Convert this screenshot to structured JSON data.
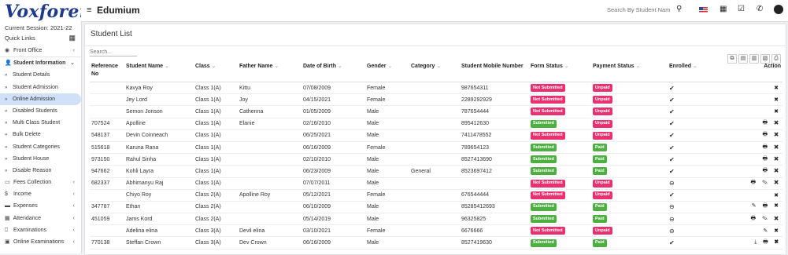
{
  "app": {
    "logo": "Voxforem",
    "title": "Edumium"
  },
  "sidebar": {
    "session": "Current Session: 2021-22",
    "quick_links": "Quick Links",
    "items": [
      {
        "label": "Front Office",
        "icon": "eye-icon",
        "type": "top",
        "chev": "‹"
      },
      {
        "label": "Student Information",
        "icon": "user-icon",
        "type": "bold",
        "chev": "⌄"
      },
      {
        "label": "Student Details",
        "type": "sub"
      },
      {
        "label": "Student Admission",
        "type": "sub"
      },
      {
        "label": "Online Admission",
        "type": "sub",
        "active": true
      },
      {
        "label": "Disabled Students",
        "type": "sub"
      },
      {
        "label": "Multi Class Student",
        "type": "sub"
      },
      {
        "label": "Bulk Delete",
        "type": "sub"
      },
      {
        "label": "Student Categories",
        "type": "sub"
      },
      {
        "label": "Student House",
        "type": "sub"
      },
      {
        "label": "Disable Reason",
        "type": "sub"
      },
      {
        "label": "Fees Collection",
        "icon": "money-icon",
        "chev": "‹"
      },
      {
        "label": "Income",
        "icon": "dollar-icon",
        "chev": "‹"
      },
      {
        "label": "Expenses",
        "icon": "card-icon",
        "chev": "‹"
      },
      {
        "label": "Attendance",
        "icon": "calendar-icon",
        "chev": "‹"
      },
      {
        "label": "Examinations",
        "icon": "book-icon",
        "chev": "‹"
      },
      {
        "label": "Online Examinations",
        "icon": "laptop-icon",
        "chev": "‹"
      }
    ]
  },
  "topbar": {
    "search_placeholder": "Search By Student Name"
  },
  "panel": {
    "title": "Student List",
    "search_placeholder": "Search..."
  },
  "table": {
    "headers": [
      "Reference No",
      "Student Name",
      "Class",
      "Father Name",
      "Date of Birth",
      "Gender",
      "Category",
      "Student Mobile Number",
      "Form Status",
      "Payment Status",
      "Enrolled",
      "Action"
    ],
    "rows": [
      {
        "ref": "",
        "name": "Kavya Roy",
        "class": "Class 1(A)",
        "father": "Kittu",
        "dob": "07/08/2009",
        "gender": "Female",
        "category": "",
        "mobile": "987654311",
        "form": "Not Submitted",
        "payment": "Unpaid",
        "enrolled": "✔",
        "actions": "✖"
      },
      {
        "ref": "",
        "name": "Jey Lord",
        "class": "Class 1(A)",
        "father": "Joy",
        "dob": "04/15/2021",
        "gender": "Female",
        "category": "",
        "mobile": "2289292929",
        "form": "Not Submitted",
        "payment": "Unpaid",
        "enrolled": "✔",
        "actions": "✖"
      },
      {
        "ref": "",
        "name": "Semon Jonson",
        "class": "Class 1(A)",
        "father": "Cathenna",
        "dob": "01/05/2009",
        "gender": "Male",
        "category": "",
        "mobile": "787654444",
        "form": "Not Submitted",
        "payment": "Unpaid",
        "enrolled": "✔",
        "actions": "✖"
      },
      {
        "ref": "707524",
        "name": "Apolline",
        "class": "Class 1(A)",
        "father": "Elanie",
        "dob": "02/16/2010",
        "gender": "Male",
        "category": "",
        "mobile": "895412630",
        "form": "Submitted",
        "payment": "Unpaid",
        "enrolled": "✔",
        "actions": "🖶 ✖"
      },
      {
        "ref": "548137",
        "name": "Devin Coinneach",
        "class": "Class 1(A)",
        "father": "",
        "dob": "06/25/2021",
        "gender": "Male",
        "category": "",
        "mobile": "7411478552",
        "form": "Not Submitted",
        "payment": "Unpaid",
        "enrolled": "✔",
        "actions": "🖶 ✖"
      },
      {
        "ref": "515618",
        "name": "Karuna Rana",
        "class": "Class 1(A)",
        "father": "",
        "dob": "06/16/2009",
        "gender": "Female",
        "category": "",
        "mobile": "789654123",
        "form": "Submitted",
        "payment": "Paid",
        "enrolled": "✔",
        "actions": "🖶 ✖"
      },
      {
        "ref": "973150",
        "name": "Rahul Sinha",
        "class": "Class 1(A)",
        "father": "",
        "dob": "02/10/2010",
        "gender": "Male",
        "category": "",
        "mobile": "8527413690",
        "form": "Submitted",
        "payment": "Paid",
        "enrolled": "✔",
        "actions": "🖶 ✖"
      },
      {
        "ref": "947662",
        "name": "Kohli Layra",
        "class": "Class 1(A)",
        "father": "",
        "dob": "06/23/2009",
        "gender": "Male",
        "category": "General",
        "mobile": "8523697412",
        "form": "Submitted",
        "payment": "Paid",
        "enrolled": "✔",
        "actions": "🖶 ✖"
      },
      {
        "ref": "682337",
        "name": "Abhimanyu Raj",
        "class": "Class 1(A)",
        "father": "",
        "dob": "07/07/2011",
        "gender": "Male",
        "category": "",
        "mobile": "",
        "form": "Not Submitted",
        "payment": "Unpaid",
        "enrolled": "⊖",
        "actions": "🖶 ✎ ✖"
      },
      {
        "ref": "",
        "name": "Chiyo Roy",
        "class": "Class 2(A)",
        "father": "Apolline Roy",
        "dob": "05/12/2021",
        "gender": "Female",
        "category": "",
        "mobile": "676544444",
        "form": "Not Submitted",
        "payment": "Unpaid",
        "enrolled": "✔",
        "actions": "✖"
      },
      {
        "ref": "347787",
        "name": "Ethan",
        "class": "Class 2(A)",
        "father": "",
        "dob": "06/10/2009",
        "gender": "Male",
        "category": "",
        "mobile": "85285412693",
        "form": "Submitted",
        "payment": "Paid",
        "enrolled": "⊖",
        "actions": "✎ 🖶 ✖"
      },
      {
        "ref": "451059",
        "name": "Jams Kord",
        "class": "Class 2(A)",
        "father": "",
        "dob": "05/14/2019",
        "gender": "Male",
        "category": "",
        "mobile": "96325825",
        "form": "Submitted",
        "payment": "Paid",
        "enrolled": "⊖",
        "actions": "🖶 ✎ ✖"
      },
      {
        "ref": "",
        "name": "Adelina elina",
        "class": "Class 3(A)",
        "father": "Devil elina",
        "dob": "03/10/2021",
        "gender": "Female",
        "category": "",
        "mobile": "6676666",
        "form": "Not Submitted",
        "payment": "Unpaid",
        "enrolled": "⊖",
        "actions": "✎ ✖"
      },
      {
        "ref": "770138",
        "name": "Steffan Crown",
        "class": "Class 3(A)",
        "father": "Dev Crown",
        "dob": "06/16/2009",
        "gender": "Male",
        "category": "",
        "mobile": "8527419630",
        "form": "Submitted",
        "payment": "Paid",
        "enrolled": "✔",
        "actions": "⤓ 🖶 ✖"
      }
    ]
  },
  "colors": {
    "submitted": "#4caf3f",
    "not_submitted": "#e8316e",
    "paid": "#4caf3f",
    "unpaid": "#e8316e",
    "accent": "#1f3a8a"
  }
}
